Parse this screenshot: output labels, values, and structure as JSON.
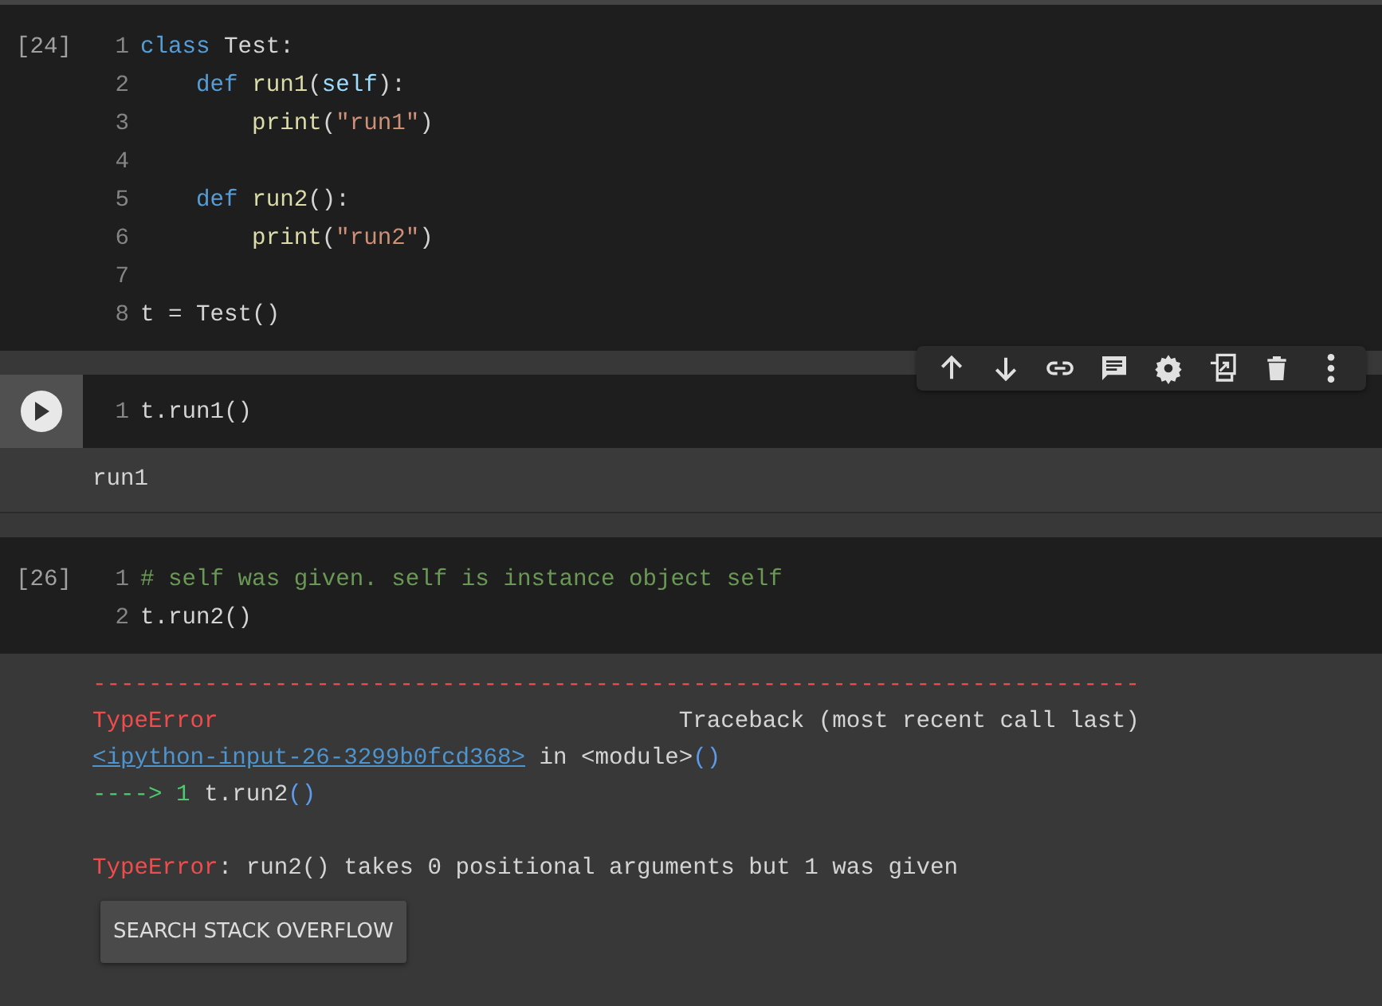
{
  "cells": [
    {
      "selected": false,
      "execution_count": "[24]",
      "code": [
        {
          "number": "1",
          "tokens": [
            {
              "kind": "keyword",
              "text": "class"
            },
            {
              "kind": "plain",
              "text": " Test:"
            }
          ]
        },
        {
          "number": "2",
          "tokens": [
            {
              "kind": "keyword",
              "text": "    def"
            },
            {
              "kind": "function",
              "text": " run1"
            },
            {
              "kind": "plain",
              "text": "("
            },
            {
              "kind": "param",
              "text": "self"
            },
            {
              "kind": "plain",
              "text": "):"
            }
          ]
        },
        {
          "number": "3",
          "tokens": [
            {
              "kind": "function",
              "text": "        print"
            },
            {
              "kind": "plain",
              "text": "("
            },
            {
              "kind": "string",
              "text": "\"run1\""
            },
            {
              "kind": "plain",
              "text": ")"
            }
          ]
        },
        {
          "number": "4"
        },
        {
          "number": "5",
          "tokens": [
            {
              "kind": "keyword",
              "text": "    def"
            },
            {
              "kind": "function",
              "text": " run2"
            },
            {
              "kind": "plain",
              "text": "():"
            }
          ]
        },
        {
          "number": "6",
          "tokens": [
            {
              "kind": "function",
              "text": "        print"
            },
            {
              "kind": "plain",
              "text": "("
            },
            {
              "kind": "string",
              "text": "\"run2\""
            },
            {
              "kind": "plain",
              "text": ")"
            }
          ]
        },
        {
          "number": "7"
        },
        {
          "number": "8",
          "tokens": [
            {
              "kind": "plain",
              "text": "t = Test()"
            }
          ]
        }
      ]
    },
    {
      "selected": true,
      "code": [
        {
          "number": "1",
          "tokens": [
            {
              "kind": "plain",
              "text": "t.run1()"
            }
          ]
        }
      ],
      "output": {
        "blocks": [
          [
            [
              {
                "kind": "plain",
                "text": "run1"
              }
            ]
          ]
        ]
      }
    },
    {
      "selected": false,
      "execution_count": "[26]",
      "code": [
        {
          "number": "1",
          "tokens": [
            {
              "kind": "comment",
              "text": "# self was given. self is instance object self"
            }
          ]
        },
        {
          "number": "2",
          "tokens": [
            {
              "kind": "plain",
              "text": "t.run2()"
            }
          ]
        }
      ],
      "output": {
        "blocks": [
          [
            [
              {
                "kind": "error",
                "text": "---------------------------------------------------------------------------"
              }
            ],
            [
              {
                "kind": "error",
                "text": "TypeError"
              },
              {
                "kind": "plain",
                "text": "                                 Traceback (most recent call last)"
              }
            ],
            [
              {
                "kind": "link",
                "text": "<ipython-input-26-3299b0fcd368>"
              },
              {
                "kind": "plain",
                "text": " in <module>"
              },
              {
                "kind": "paren",
                "text": "()"
              }
            ],
            [
              {
                "kind": "arrow",
                "text": "----> 1"
              },
              {
                "kind": "plain",
                "text": " t.run2"
              },
              {
                "kind": "paren",
                "text": "()"
              }
            ]
          ],
          [
            [
              {
                "kind": "error",
                "text": "TypeError"
              },
              {
                "kind": "plain",
                "text": ": run2() takes 0 positional arguments but 1 was given"
              }
            ]
          ]
        ],
        "button": "SEARCH STACK OVERFLOW"
      }
    }
  ]
}
